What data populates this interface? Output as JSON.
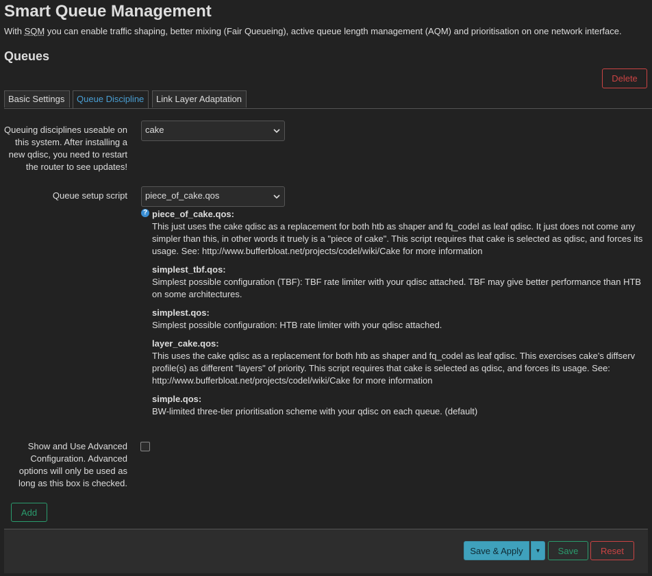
{
  "page": {
    "title": "Smart Queue Management",
    "description_before": "With ",
    "description_abbr": "SQM",
    "description_after": " you can enable traffic shaping, better mixing (Fair Queueing), active queue length management (AQM) and prioritisation on one network interface.",
    "section_title": "Queues"
  },
  "actions": {
    "delete": "Delete",
    "add": "Add"
  },
  "tabs": [
    {
      "label": "Basic Settings",
      "active": false
    },
    {
      "label": "Queue Discipline",
      "active": true
    },
    {
      "label": "Link Layer Adaptation",
      "active": false
    }
  ],
  "fields": {
    "qdisc": {
      "label": "Queuing disciplines useable on this system. After installing a new qdisc, you need to restart the router to see updates!",
      "value": "cake"
    },
    "script": {
      "label": "Queue setup script",
      "value": "piece_of_cake.qos"
    },
    "advanced": {
      "label": "Show and Use Advanced Configuration. Advanced options will only be used as long as this box is checked.",
      "checked": false
    }
  },
  "scripts_help": [
    {
      "name": "piece_of_cake.qos:",
      "text": "This just uses the cake qdisc as a replacement for both htb as shaper and fq_codel as leaf qdisc. It just does not come any simpler than this, in other words it truely is a \"piece of cake\". This script requires that cake is selected as qdisc, and forces its usage. See: http://www.bufferbloat.net/projects/codel/wiki/Cake for more information"
    },
    {
      "name": "simplest_tbf.qos:",
      "text": "Simplest possible configuration (TBF): TBF rate limiter with your qdisc attached. TBF may give better performance than HTB on some architectures."
    },
    {
      "name": "simplest.qos:",
      "text": "Simplest possible configuration: HTB rate limiter with your qdisc attached."
    },
    {
      "name": "layer_cake.qos:",
      "text": "This uses the cake qdisc as a replacement for both htb as shaper and fq_codel as leaf qdisc. This exercises cake's diffserv profile(s) as different \"layers\" of priority. This script requires that cake is selected as qdisc, and forces its usage. See: http://www.bufferbloat.net/projects/codel/wiki/Cake for more information"
    },
    {
      "name": "simple.qos:",
      "text": "BW-limited three-tier prioritisation scheme with your qdisc on each queue. (default)"
    }
  ],
  "footer": {
    "save_apply": "Save & Apply",
    "caret": "▾",
    "save": "Save",
    "reset": "Reset"
  },
  "icons": {
    "help": "help-icon",
    "select_chevron": "chevron-down-icon",
    "split_caret": "caret-down-icon"
  },
  "colors": {
    "background": "#222222",
    "text": "#dddddd",
    "accent_blue": "#4a9fd4",
    "primary_button": "#3fa1bc",
    "positive": "#2a9d6e",
    "negative": "#cc4444"
  }
}
